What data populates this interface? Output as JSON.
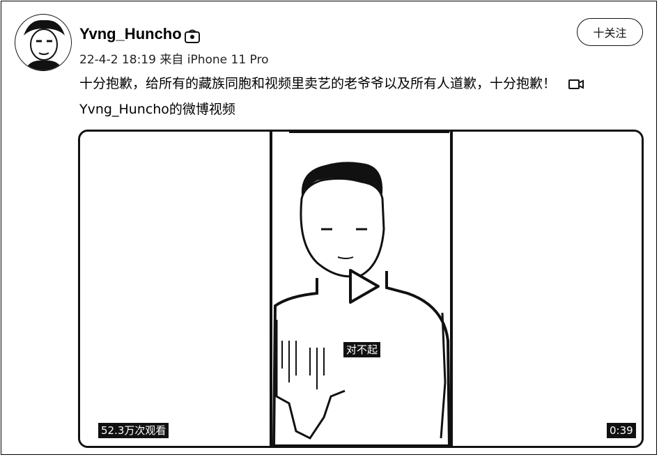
{
  "post": {
    "username": "Yvng_Huncho",
    "meta": "22-4-2 18:19  来自 iPhone 11 Pro",
    "follow_label": "十关注",
    "text": "十分抱歉，给所有的藏族同胞和视频里卖艺的老爷爷以及所有人道歉，十分抱歉！",
    "video_source": "Yvng_Huncho的微博视频"
  },
  "video": {
    "subtitle": "对不起",
    "views": "52.3万次观看",
    "duration": "0:39"
  },
  "icons": {
    "verified": "verified-badge-icon",
    "video": "video-camera-icon",
    "play": "play-icon"
  }
}
